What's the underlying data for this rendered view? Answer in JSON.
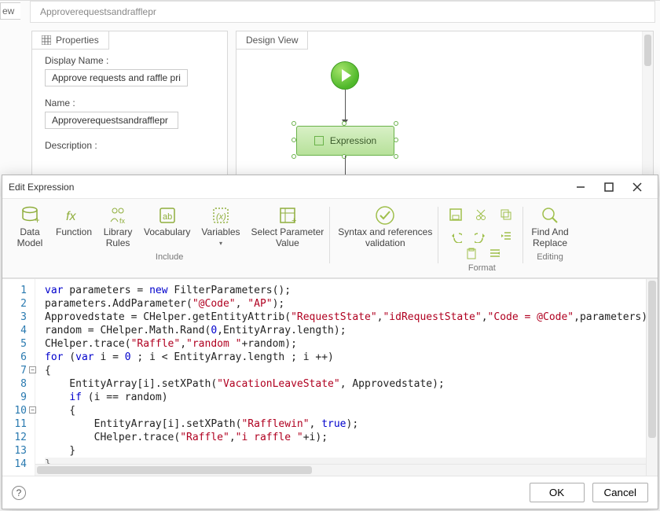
{
  "bg": {
    "left_tab": "ew",
    "title": "Approverequestsandrafflepr",
    "properties_tab": "Properties",
    "design_tab": "Design View",
    "props": {
      "display_name_label": "Display Name :",
      "display_name_value": "Approve requests and raffle pri",
      "name_label": "Name :",
      "name_value": "Approverequestsandrafflepr",
      "description_label": "Description :"
    },
    "expression_node": "Expression"
  },
  "dialog": {
    "title": "Edit Expression",
    "ribbon": {
      "include_caption": "Include",
      "format_caption": "Format",
      "editing_caption": "Editing",
      "data_model": "Data\nModel",
      "function": "Function",
      "library_rules": "Library\nRules",
      "vocabulary": "Vocabulary",
      "variables": "Variables",
      "select_parameter_value": "Select Parameter\nValue",
      "syntax_validation": "Syntax and references\nvalidation",
      "find_replace": "Find And\nReplace"
    },
    "buttons": {
      "ok": "OK",
      "cancel": "Cancel"
    },
    "code_lines": [
      {
        "n": 1,
        "tokens": [
          [
            "kw",
            "var"
          ],
          [
            "",
            " parameters = "
          ],
          [
            "kw",
            "new"
          ],
          [
            "",
            " FilterParameters();"
          ]
        ]
      },
      {
        "n": 2,
        "tokens": [
          [
            "",
            "parameters.AddParameter("
          ],
          [
            "str",
            "\"@Code\""
          ],
          [
            "",
            ", "
          ],
          [
            "str",
            "\"AP\""
          ],
          [
            "",
            ");"
          ]
        ]
      },
      {
        "n": 3,
        "tokens": [
          [
            "",
            "Approvedstate = CHelper.getEntityAttrib("
          ],
          [
            "str",
            "\"RequestState\""
          ],
          [
            "",
            ","
          ],
          [
            "str",
            "\"idRequestState\""
          ],
          [
            "",
            ","
          ],
          [
            "str",
            "\"Code = @Code\""
          ],
          [
            "",
            ",parameters);"
          ]
        ]
      },
      {
        "n": 4,
        "tokens": [
          [
            "",
            "random = CHelper.Math.Rand("
          ],
          [
            "num",
            "0"
          ],
          [
            "",
            ",EntityArray.length);"
          ]
        ]
      },
      {
        "n": 5,
        "tokens": [
          [
            "",
            "CHelper.trace("
          ],
          [
            "str",
            "\"Raffle\""
          ],
          [
            "",
            ","
          ],
          [
            "str",
            "\"random \""
          ],
          [
            "",
            "+random);"
          ]
        ]
      },
      {
        "n": 6,
        "tokens": [
          [
            "kw",
            "for"
          ],
          [
            "",
            " ("
          ],
          [
            "kw",
            "var"
          ],
          [
            "",
            " i = "
          ],
          [
            "num",
            "0"
          ],
          [
            "",
            " ; i < EntityArray.length ; i ++)"
          ]
        ]
      },
      {
        "n": 7,
        "fold": true,
        "tokens": [
          [
            "",
            "{"
          ]
        ]
      },
      {
        "n": 8,
        "tokens": [
          [
            "",
            "    EntityArray[i].setXPath("
          ],
          [
            "str",
            "\"VacationLeaveState\""
          ],
          [
            "",
            ", Approvedstate);"
          ]
        ]
      },
      {
        "n": 9,
        "tokens": [
          [
            "",
            "    "
          ],
          [
            "kw",
            "if"
          ],
          [
            "",
            " (i == random)"
          ]
        ]
      },
      {
        "n": 10,
        "fold": true,
        "tokens": [
          [
            "",
            "    {"
          ]
        ]
      },
      {
        "n": 11,
        "tokens": [
          [
            "",
            "        EntityArray[i].setXPath("
          ],
          [
            "str",
            "\"Rafflewin\""
          ],
          [
            "",
            ", "
          ],
          [
            "kw",
            "true"
          ],
          [
            "",
            ");"
          ]
        ]
      },
      {
        "n": 12,
        "tokens": [
          [
            "",
            "        CHelper.trace("
          ],
          [
            "str",
            "\"Raffle\""
          ],
          [
            "",
            ","
          ],
          [
            "str",
            "\"i raffle \""
          ],
          [
            "",
            "+i);"
          ]
        ]
      },
      {
        "n": 13,
        "tokens": [
          [
            "",
            "    }"
          ]
        ]
      },
      {
        "n": 14,
        "current": true,
        "tokens": [
          [
            "dim",
            "}"
          ]
        ]
      }
    ]
  }
}
